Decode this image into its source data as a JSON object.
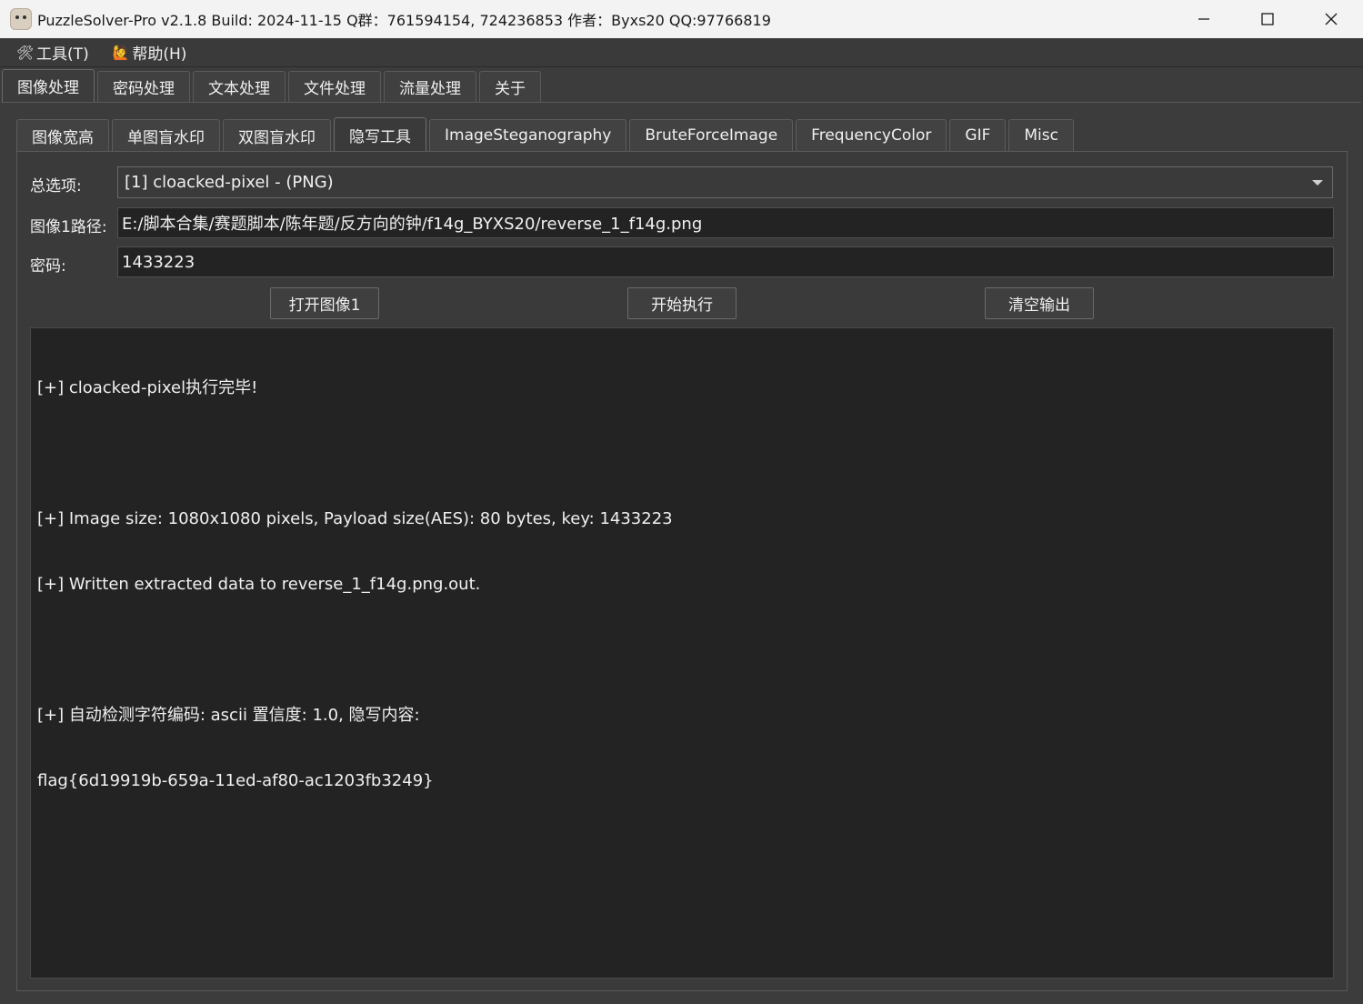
{
  "window": {
    "title": "PuzzleSolver-Pro v2.1.8  Build: 2024-11-15  Q群：761594154, 724236853  作者：Byxs20  QQ:97766819"
  },
  "menu": [
    {
      "icon": "🛠",
      "label": "工具(T)"
    },
    {
      "icon": "🙋",
      "label": "帮助(H)"
    }
  ],
  "main_tabs": [
    "图像处理",
    "密码处理",
    "文本处理",
    "文件处理",
    "流量处理",
    "关于"
  ],
  "main_tab_active": "图像处理",
  "sub_tabs": [
    "图像宽高",
    "单图盲水印",
    "双图盲水印",
    "隐写工具",
    "ImageSteganography",
    "BruteForceImage",
    "FrequencyColor",
    "GIF",
    "Misc"
  ],
  "sub_tab_active": "隐写工具",
  "form": {
    "option_label": "总选项:",
    "option_value": "[1] cloacked-pixel - (PNG)",
    "path_label": "图像1路径:",
    "path_value": "E:/脚本合集/赛题脚本/陈年题/反方向的钟/f14g_BYXS20/reverse_1_f14g.png",
    "password_label": "密码:",
    "password_value": "1433223"
  },
  "buttons": {
    "open": "打开图像1",
    "run": "开始执行",
    "clear": "清空输出"
  },
  "output": [
    "[+] cloacked-pixel执行完毕!",
    "",
    "[+] Image size: 1080x1080 pixels, Payload size(AES): 80 bytes, key: 1433223",
    "[+] Written extracted data to reverse_1_f14g.png.out.",
    "",
    "[+] 自动检测字符编码: ascii 置信度: 1.0, 隐写内容:",
    "flag{6d19919b-659a-11ed-af80-ac1203fb3249}"
  ]
}
